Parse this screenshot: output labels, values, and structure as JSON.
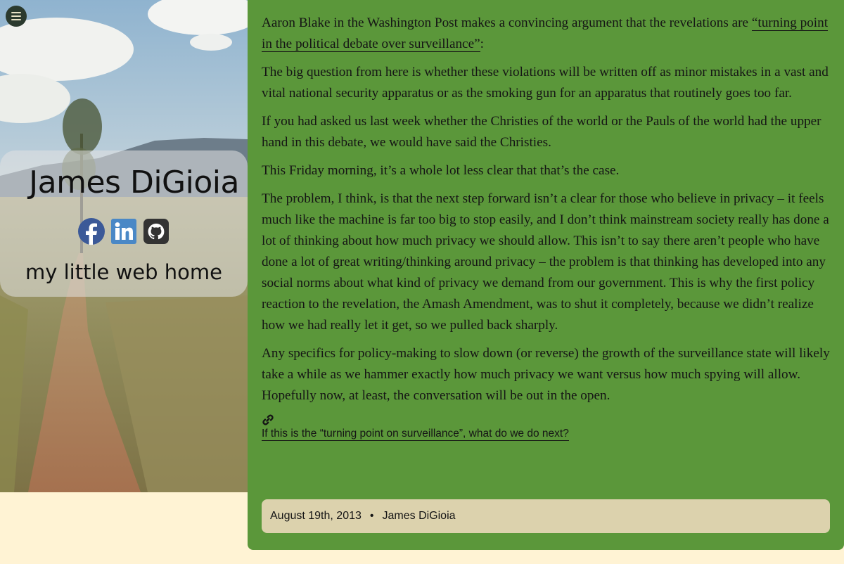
{
  "sidebar": {
    "menu_icon": "hamburger-menu-icon",
    "site_name": "James DiGioia",
    "tagline": "my little web home",
    "social": [
      {
        "name": "facebook-icon",
        "color": "#3b5998"
      },
      {
        "name": "linkedin-icon",
        "color": "#4a88c6"
      },
      {
        "name": "github-icon",
        "color": "#333333"
      }
    ]
  },
  "article": {
    "intro_before": "Aaron Blake in the Washington Post makes a convincing argument that the revelations are ",
    "intro_link": "“turning point in the political debate over surveillance”",
    "intro_after": ":",
    "paragraphs": [
      "The big question from here is whether these violations will be written off as minor mistakes in a vast and vital national security apparatus or as the smoking gun for an apparatus that routinely goes too far.",
      "If you had asked us last week whether the Christies of the world or the Pauls of the world had the upper hand in this debate, we would have said the Christies.",
      "This Friday morning, it’s a whole lot less clear that that’s the case.",
      "The problem, I think, is that the next step forward isn’t a clear for those who believe in privacy – it feels much like the machine is far too big to stop easily, and I don’t think mainstream society really has done a lot of thinking about how much privacy we should allow. This isn’t to say there aren’t people who have done a lot of great writing/thinking around privacy – the problem is that thinking has developed into any social norms about what kind of privacy we demand from our government. This is why the first policy reaction to the revelation, the Amash Amendment, was to shut it completely, because we didn’t realize how we had really let it get, so we pulled back sharply.",
      "Any specifics for policy-making to slow down (or reverse) the growth of the surveillance state will likely take a while as we hammer exactly how much privacy we want versus how much spying will allow. Hopefully now, at least, the conversation will be out in the open."
    ],
    "permalink_icon": "link-icon",
    "title_link": "If this is the “turning point on surveillance”, what do we do next?",
    "meta": {
      "date": "August 19th, 2013",
      "separator": "•",
      "author": "James DiGioia"
    }
  },
  "colors": {
    "page_background": "#fff3d4",
    "article_background": "#5b973a",
    "meta_background": "#dcd2ad"
  }
}
